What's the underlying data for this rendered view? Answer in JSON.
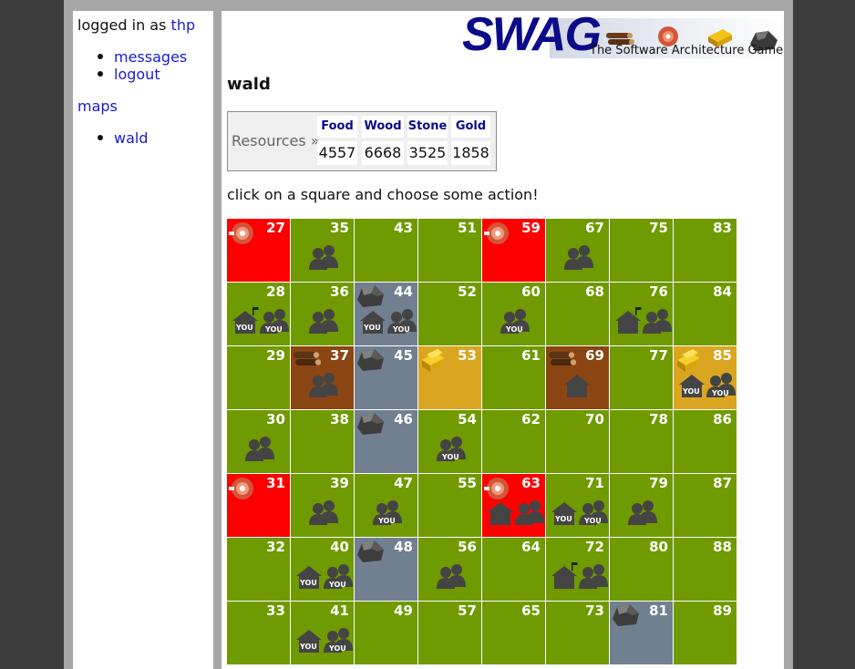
{
  "sidebar": {
    "logged_in_prefix": "logged in as",
    "username": "thp",
    "user_links": [
      {
        "label": "messages"
      },
      {
        "label": "logout"
      }
    ],
    "maps_label": "maps",
    "map_links": [
      {
        "label": "wald"
      }
    ]
  },
  "logo": {
    "title": "SWAG",
    "subtitle": "The Software Architecture Game"
  },
  "main": {
    "title": "wald",
    "resources_label": "Resources »",
    "resources": [
      {
        "name": "Food",
        "value": "4557"
      },
      {
        "name": "Wood",
        "value": "6668"
      },
      {
        "name": "Stone",
        "value": "3525"
      },
      {
        "name": "Gold",
        "value": "1858"
      }
    ],
    "instruction": "click on a square and choose some action!",
    "you_label": "YOU"
  },
  "colors": {
    "grass": "#6f9a00",
    "food": "#ff0000",
    "wood": "#8b4513",
    "stone": "#708090",
    "gold": "#daa520"
  },
  "grid": {
    "rows": [
      [
        {
          "n": "27",
          "terrain": "food",
          "resource": "meat-icon"
        },
        {
          "n": "35",
          "terrain": "grass",
          "army": true
        },
        {
          "n": "43",
          "terrain": "grass"
        },
        {
          "n": "51",
          "terrain": "grass"
        },
        {
          "n": "59",
          "terrain": "food",
          "resource": "meat-icon"
        },
        {
          "n": "67",
          "terrain": "grass",
          "army": true
        },
        {
          "n": "75",
          "terrain": "grass"
        },
        {
          "n": "83",
          "terrain": "grass"
        }
      ],
      [
        {
          "n": "28",
          "terrain": "grass",
          "house": true,
          "house_you": true,
          "flag": true,
          "army": true,
          "army_you": true
        },
        {
          "n": "36",
          "terrain": "grass",
          "army": true
        },
        {
          "n": "44",
          "terrain": "stone",
          "resource": "rock-icon",
          "house": true,
          "house_you": true,
          "army": true,
          "army_you": true
        },
        {
          "n": "52",
          "terrain": "grass"
        },
        {
          "n": "60",
          "terrain": "grass",
          "army": true,
          "army_you": true
        },
        {
          "n": "68",
          "terrain": "grass"
        },
        {
          "n": "76",
          "terrain": "grass",
          "house": true,
          "flag": true,
          "army": true
        },
        {
          "n": "84",
          "terrain": "grass"
        }
      ],
      [
        {
          "n": "29",
          "terrain": "grass"
        },
        {
          "n": "37",
          "terrain": "wood",
          "resource": "logs-icon",
          "army": true
        },
        {
          "n": "45",
          "terrain": "stone",
          "resource": "rock-icon"
        },
        {
          "n": "53",
          "terrain": "gold",
          "resource": "gold-bars-icon"
        },
        {
          "n": "61",
          "terrain": "grass"
        },
        {
          "n": "69",
          "terrain": "wood",
          "resource": "logs-icon",
          "house": true,
          "house_center": true
        },
        {
          "n": "77",
          "terrain": "grass"
        },
        {
          "n": "85",
          "terrain": "gold",
          "resource": "gold-bars-icon",
          "house": true,
          "house_you": true,
          "army": true,
          "army_you": true
        }
      ],
      [
        {
          "n": "30",
          "terrain": "grass",
          "army": true
        },
        {
          "n": "38",
          "terrain": "grass"
        },
        {
          "n": "46",
          "terrain": "stone",
          "resource": "rock-icon"
        },
        {
          "n": "54",
          "terrain": "grass",
          "army": true,
          "army_you": true
        },
        {
          "n": "62",
          "terrain": "grass"
        },
        {
          "n": "70",
          "terrain": "grass"
        },
        {
          "n": "78",
          "terrain": "grass"
        },
        {
          "n": "86",
          "terrain": "grass"
        }
      ],
      [
        {
          "n": "31",
          "terrain": "food",
          "resource": "meat-icon"
        },
        {
          "n": "39",
          "terrain": "grass",
          "army": true
        },
        {
          "n": "47",
          "terrain": "grass",
          "army": true,
          "army_you": true
        },
        {
          "n": "55",
          "terrain": "grass"
        },
        {
          "n": "63",
          "terrain": "food",
          "resource": "meat-icon",
          "house": true,
          "army": true
        },
        {
          "n": "71",
          "terrain": "grass",
          "house": true,
          "house_you": true,
          "army": true,
          "army_you": true
        },
        {
          "n": "79",
          "terrain": "grass",
          "army": true
        },
        {
          "n": "87",
          "terrain": "grass"
        }
      ],
      [
        {
          "n": "32",
          "terrain": "grass"
        },
        {
          "n": "40",
          "terrain": "grass",
          "house": true,
          "house_you": true,
          "army": true,
          "army_you": true
        },
        {
          "n": "48",
          "terrain": "stone",
          "resource": "rock-icon"
        },
        {
          "n": "56",
          "terrain": "grass",
          "army": true
        },
        {
          "n": "64",
          "terrain": "grass"
        },
        {
          "n": "72",
          "terrain": "grass",
          "house": true,
          "flag": true,
          "army": true
        },
        {
          "n": "80",
          "terrain": "grass"
        },
        {
          "n": "88",
          "terrain": "grass"
        }
      ],
      [
        {
          "n": "33",
          "terrain": "grass"
        },
        {
          "n": "41",
          "terrain": "grass",
          "house": true,
          "house_you": true,
          "army": true,
          "army_you": true
        },
        {
          "n": "49",
          "terrain": "grass"
        },
        {
          "n": "57",
          "terrain": "grass"
        },
        {
          "n": "65",
          "terrain": "grass"
        },
        {
          "n": "73",
          "terrain": "grass"
        },
        {
          "n": "81",
          "terrain": "stone",
          "resource": "rock-icon"
        },
        {
          "n": "89",
          "terrain": "grass"
        }
      ]
    ]
  }
}
